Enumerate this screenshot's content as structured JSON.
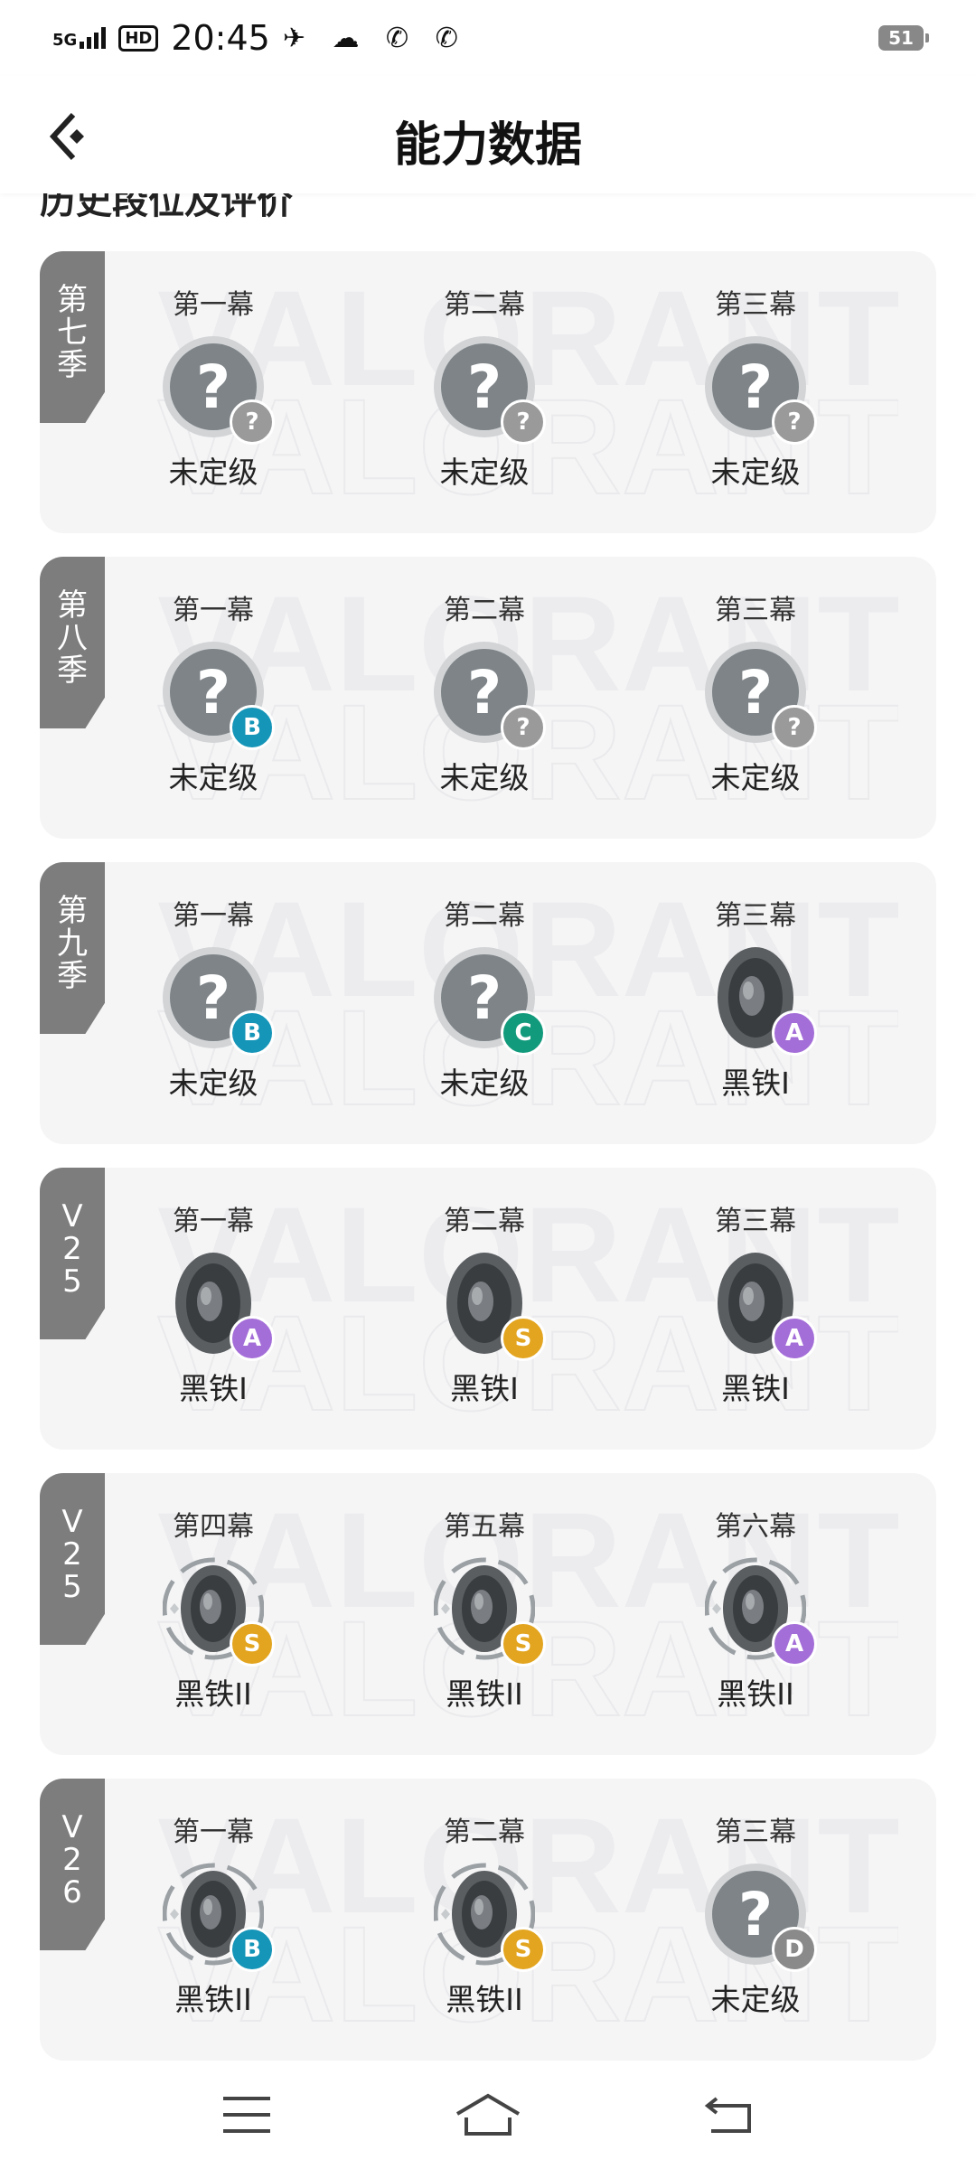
{
  "status_bar": {
    "network": "5G",
    "hd": "HD",
    "time": "20:45",
    "icons": "✈ ☁ ✆ ✆",
    "battery": "51"
  },
  "header": {
    "title": "能力数据"
  },
  "section_title": "历史段位及评价",
  "colors": {
    "tag_bg": "#7d7d7d",
    "card_bg": "#f5f5f6",
    "grade_A": "#a46ed8",
    "grade_B": "#1595b8",
    "grade_C": "#129a7c",
    "grade_D": "#8a8a8a",
    "grade_S": "#e3a51f",
    "grade_unknown": "#9a9a9a"
  },
  "seasons": [
    {
      "tag": [
        "第",
        "七",
        "季"
      ],
      "acts": [
        {
          "name": "第一幕",
          "rank": "未定级",
          "icon": "unranked-icon",
          "grade": "?"
        },
        {
          "name": "第二幕",
          "rank": "未定级",
          "icon": "unranked-icon",
          "grade": "?"
        },
        {
          "name": "第三幕",
          "rank": "未定级",
          "icon": "unranked-icon",
          "grade": "?"
        }
      ]
    },
    {
      "tag": [
        "第",
        "八",
        "季"
      ],
      "acts": [
        {
          "name": "第一幕",
          "rank": "未定级",
          "icon": "unranked-icon",
          "grade": "B"
        },
        {
          "name": "第二幕",
          "rank": "未定级",
          "icon": "unranked-icon",
          "grade": "?"
        },
        {
          "name": "第三幕",
          "rank": "未定级",
          "icon": "unranked-icon",
          "grade": "?"
        }
      ]
    },
    {
      "tag": [
        "第",
        "九",
        "季"
      ],
      "acts": [
        {
          "name": "第一幕",
          "rank": "未定级",
          "icon": "unranked-icon",
          "grade": "B"
        },
        {
          "name": "第二幕",
          "rank": "未定级",
          "icon": "unranked-icon",
          "grade": "C"
        },
        {
          "name": "第三幕",
          "rank": "黑铁I",
          "icon": "iron-1-icon",
          "grade": "A"
        }
      ]
    },
    {
      "tag": [
        "V",
        "2",
        "5"
      ],
      "acts": [
        {
          "name": "第一幕",
          "rank": "黑铁I",
          "icon": "iron-1-icon",
          "grade": "A"
        },
        {
          "name": "第二幕",
          "rank": "黑铁I",
          "icon": "iron-1-icon",
          "grade": "S"
        },
        {
          "name": "第三幕",
          "rank": "黑铁I",
          "icon": "iron-1-icon",
          "grade": "A"
        }
      ]
    },
    {
      "tag": [
        "V",
        "2",
        "5"
      ],
      "acts": [
        {
          "name": "第四幕",
          "rank": "黑铁II",
          "icon": "iron-2-icon",
          "grade": "S"
        },
        {
          "name": "第五幕",
          "rank": "黑铁II",
          "icon": "iron-2-icon",
          "grade": "S"
        },
        {
          "name": "第六幕",
          "rank": "黑铁II",
          "icon": "iron-2-icon",
          "grade": "A"
        }
      ]
    },
    {
      "tag": [
        "V",
        "2",
        "6"
      ],
      "acts": [
        {
          "name": "第一幕",
          "rank": "黑铁II",
          "icon": "iron-2-icon",
          "grade": "B"
        },
        {
          "name": "第二幕",
          "rank": "黑铁II",
          "icon": "iron-2-icon",
          "grade": "S"
        },
        {
          "name": "第三幕",
          "rank": "未定级",
          "icon": "unranked-icon",
          "grade": "D"
        }
      ]
    }
  ],
  "nav": {
    "menu_icon": "menu-icon",
    "home_icon": "home-icon",
    "back_icon": "back-arrow-icon"
  }
}
